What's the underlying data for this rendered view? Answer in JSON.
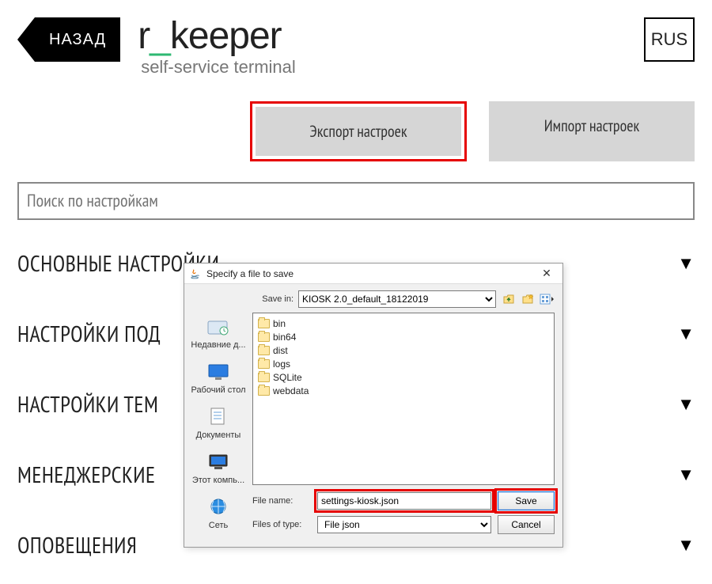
{
  "header": {
    "back_label": "НАЗАД",
    "logo_prefix": "r",
    "logo_underscore": "_",
    "logo_suffix": "keeper",
    "subtitle": "self-service terminal",
    "lang": "RUS"
  },
  "actions": {
    "export": "Экспорт настроек",
    "import": "Импорт настроек"
  },
  "search": {
    "placeholder": "Поиск по настройкам"
  },
  "sections": [
    "ОСНОВНЫЕ НАСТРОЙКИ",
    "НАСТРОЙКИ ПОД",
    "НАСТРОЙКИ ТЕМ",
    "МЕНЕДЖЕРСКИЕ",
    "ОПОВЕЩЕНИЯ"
  ],
  "dialog": {
    "title": "Specify a file to save",
    "save_in_label": "Save in:",
    "save_in_value": "KIOSK 2.0_default_18122019",
    "sidebar": [
      "Недавние д...",
      "Рабочий стол",
      "Документы",
      "Этот компь...",
      "Сеть"
    ],
    "files": [
      "bin",
      "bin64",
      "dist",
      "logs",
      "SQLite",
      "webdata"
    ],
    "filename_label": "File name:",
    "filename_value": "settings-kiosk.json",
    "filetype_label": "Files of type:",
    "filetype_value": "File json",
    "save": "Save",
    "cancel": "Cancel"
  }
}
